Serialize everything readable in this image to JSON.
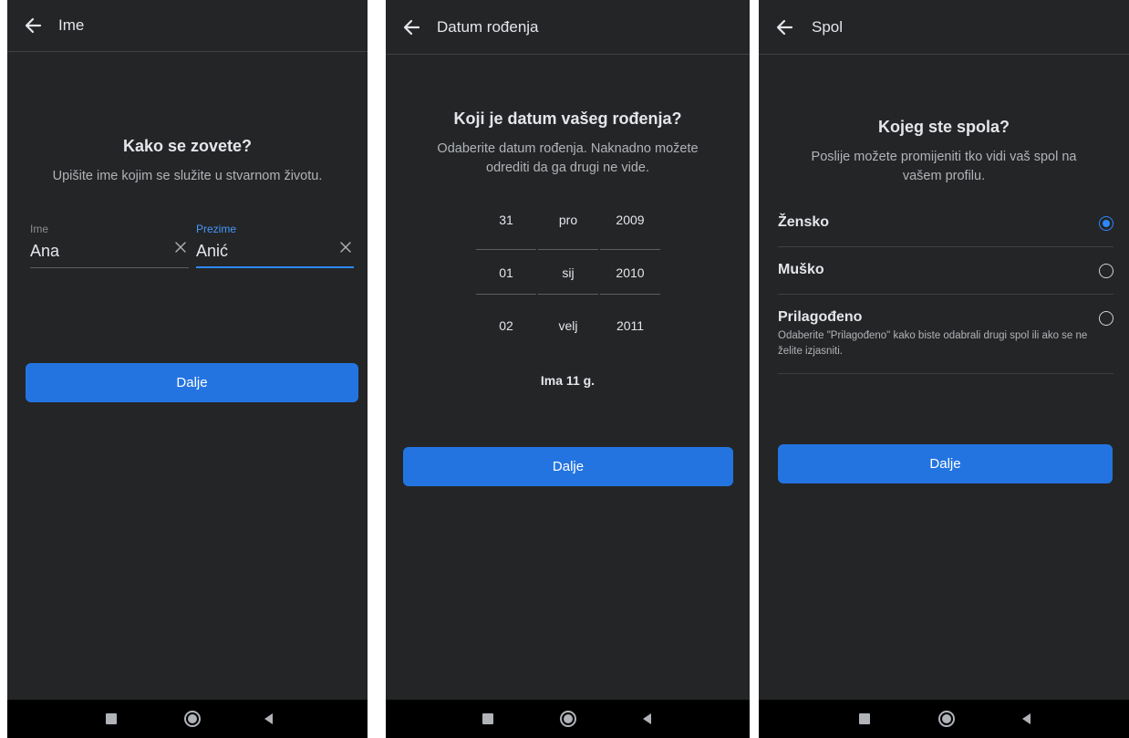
{
  "colors": {
    "background": "#242526",
    "accent": "#2374e1",
    "active_field": "#4599ff",
    "text": "#e4e6eb",
    "muted": "#b0b3b8"
  },
  "icons": {
    "back": "arrow-left-icon",
    "clear": "close-icon",
    "nav_recents": "square-icon",
    "nav_home": "circle-icon",
    "nav_back": "triangle-left-icon"
  },
  "screen_name": {
    "title": "Ime",
    "heading": "Kako se zovete?",
    "subtitle": "Upišite ime kojim se služite u stvarnom životu.",
    "first_name": {
      "label": "Ime",
      "value": "Ana"
    },
    "last_name": {
      "label": "Prezime",
      "value": "Anić"
    },
    "next_label": "Dalje"
  },
  "screen_birthday": {
    "title": "Datum rođenja",
    "heading": "Koji je datum vašeg rođenja?",
    "subtitle": "Odaberite datum rođenja. Naknadno možete odrediti da ga drugi ne vide.",
    "picker": {
      "days": [
        "31",
        "01",
        "02"
      ],
      "months": [
        "pro",
        "sij",
        "velj"
      ],
      "years": [
        "2009",
        "2010",
        "2011"
      ]
    },
    "age_text": "Ima 11 g.",
    "next_label": "Dalje"
  },
  "screen_gender": {
    "title": "Spol",
    "heading": "Kojeg ste spola?",
    "subtitle": "Poslije možete promijeniti tko vidi vaš spol na vašem profilu.",
    "options": [
      {
        "label": "Žensko",
        "selected": true
      },
      {
        "label": "Muško",
        "selected": false
      },
      {
        "label": "Prilagođeno",
        "selected": false,
        "description": "Odaberite \"Prilagođeno\" kako biste odabrali drugi spol ili ako se ne želite izjasniti."
      }
    ],
    "next_label": "Dalje"
  }
}
